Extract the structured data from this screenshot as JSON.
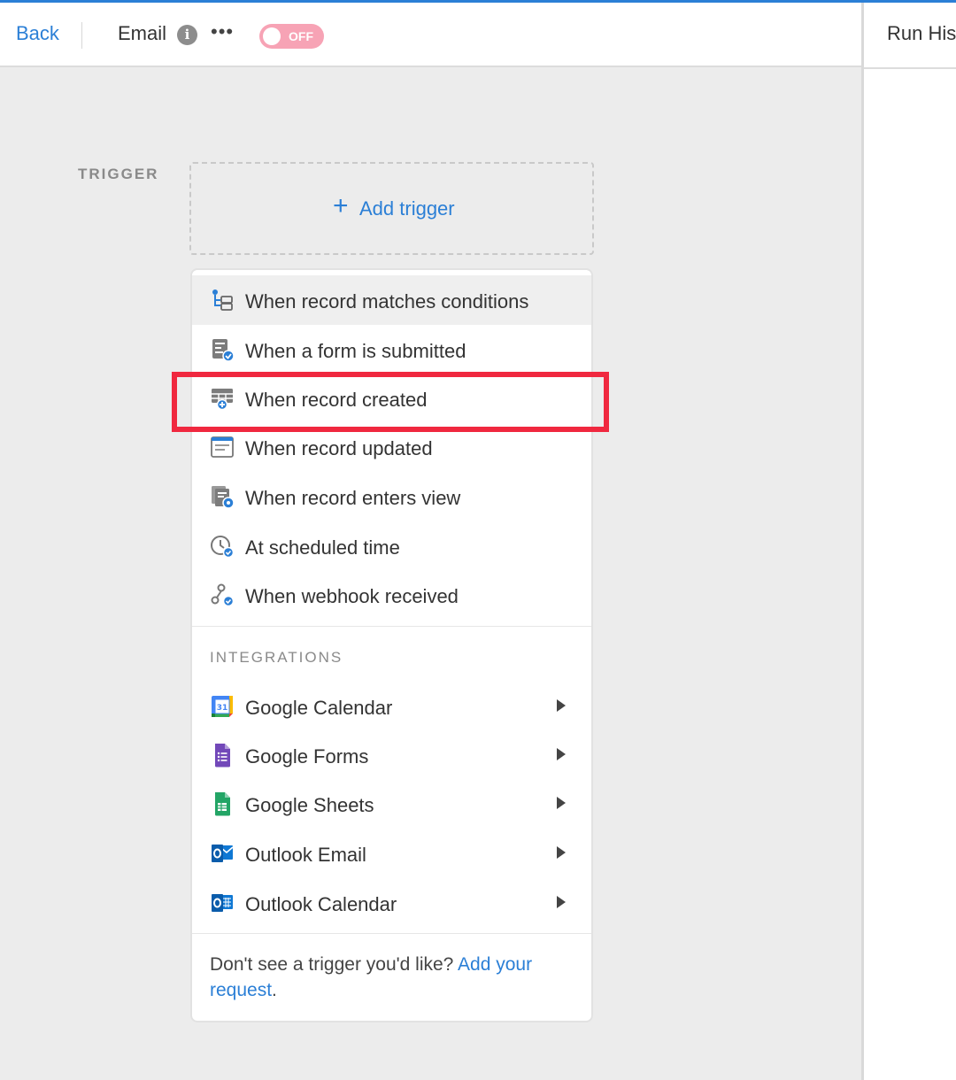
{
  "header": {
    "back_label": "Back",
    "title": "Email",
    "more_label": "•••",
    "toggle_label": "OFF",
    "right_panel_title": "Run Hist"
  },
  "trigger": {
    "section_label": "TRIGGER",
    "add_label": "Add trigger"
  },
  "menu": {
    "triggers": [
      {
        "label": "When record matches conditions",
        "icon": "conditions-icon"
      },
      {
        "label": "When a form is submitted",
        "icon": "form-submitted-icon"
      },
      {
        "label": "When record created",
        "icon": "record-created-icon"
      },
      {
        "label": "When record updated",
        "icon": "record-updated-icon"
      },
      {
        "label": "When record enters view",
        "icon": "record-enters-view-icon"
      },
      {
        "label": "At scheduled time",
        "icon": "clock-icon"
      },
      {
        "label": "When webhook received",
        "icon": "webhook-icon"
      }
    ],
    "integrations_label": "INTEGRATIONS",
    "integrations": [
      {
        "label": "Google Calendar",
        "icon": "google-calendar-icon"
      },
      {
        "label": "Google Forms",
        "icon": "google-forms-icon"
      },
      {
        "label": "Google Sheets",
        "icon": "google-sheets-icon"
      },
      {
        "label": "Outlook Email",
        "icon": "outlook-email-icon"
      },
      {
        "label": "Outlook Calendar",
        "icon": "outlook-calendar-icon"
      }
    ],
    "footer_text": "Don't see a trigger you'd like? ",
    "footer_link_1": "Add your",
    "footer_link_2": "request",
    "footer_end": "."
  },
  "colors": {
    "accent": "#2b7fd6",
    "highlight": "#f0283f",
    "toggle_off": "#f7a3b5"
  }
}
